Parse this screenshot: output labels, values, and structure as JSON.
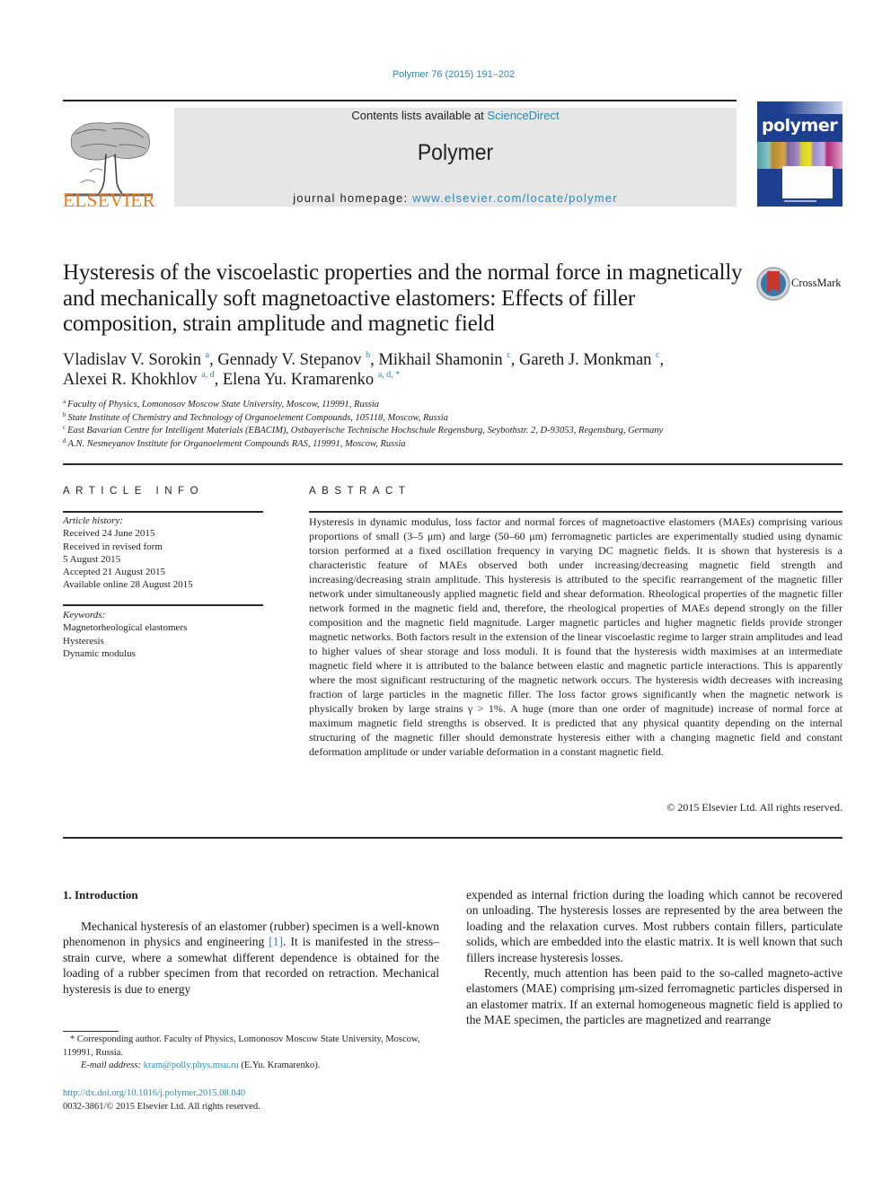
{
  "journal_ref": "Polymer 76 (2015) 191–202",
  "masthead": {
    "contents_prefix": "Contents lists available at ",
    "contents_link": "ScienceDirect",
    "journal_name": "Polymer",
    "homepage_prefix": "journal homepage: ",
    "homepage_link": "www.elsevier.com/locate/polymer"
  },
  "publisher_logo": {
    "name": "ELSEVIER",
    "icon": "elsevier-tree-icon",
    "color": "#ea7a1c"
  },
  "cover": {
    "title": "polymer",
    "icon": "journal-cover-image"
  },
  "crossmark": {
    "label": "CrossMark",
    "icon": "crossmark-icon"
  },
  "article": {
    "title": "Hysteresis of the viscoelastic properties and the normal force in magnetically and mechanically soft magnetoactive elastomers: Effects of filler composition, strain amplitude and magnetic field",
    "authors": [
      {
        "name": "Vladislav V. Sorokin",
        "sup": "a"
      },
      {
        "name": "Gennady V. Stepanov",
        "sup": "b"
      },
      {
        "name": "Mikhail Shamonin",
        "sup": "c"
      },
      {
        "name": "Gareth J. Monkman",
        "sup": "c"
      },
      {
        "name": "Alexei R. Khokhlov",
        "sup": "a, d"
      },
      {
        "name": "Elena Yu. Kramarenko",
        "sup": "a, d, *"
      }
    ],
    "affiliations": [
      {
        "key": "a",
        "text": "Faculty of Physics, Lomonosov Moscow State University, Moscow, 119991, Russia"
      },
      {
        "key": "b",
        "text": "State Institute of Chemistry and Technology of Organoelement Compounds, 105118, Moscow, Russia"
      },
      {
        "key": "c",
        "text": "East Bavarian Centre for Intelligent Materials (EBACIM), Ostbayerische Technische Hochschule Regensburg, Seybothstr. 2, D-93053, Regensburg, Germany"
      },
      {
        "key": "d",
        "text": "A.N. Nesmeyanov Institute for Organoelement Compounds RAS, 119991, Moscow, Russia"
      }
    ]
  },
  "article_info": {
    "heading": "ARTICLE INFO",
    "history_label": "Article history:",
    "history": [
      "Received 24 June 2015",
      "Received in revised form",
      "5 August 2015",
      "Accepted 21 August 2015",
      "Available online 28 August 2015"
    ],
    "keywords_label": "Keywords:",
    "keywords": [
      "Magnetorheological elastomers",
      "Hysteresis",
      "Dynamic modulus"
    ]
  },
  "abstract": {
    "heading": "ABSTRACT",
    "text": "Hysteresis in dynamic modulus, loss factor and normal forces of magnetoactive elastomers (MAEs) comprising various proportions of small (3–5 μm) and large (50–60 μm) ferromagnetic particles are experimentally studied using dynamic torsion performed at a fixed oscillation frequency in varying DC magnetic fields. It is shown that hysteresis is a characteristic feature of MAEs observed both under increasing/decreasing magnetic field strength and increasing/decreasing strain amplitude. This hysteresis is attributed to the specific rearrangement of the magnetic filler network under simultaneously applied magnetic field and shear deformation. Rheological properties of the magnetic filler network formed in the magnetic field and, therefore, the rheological properties of MAEs depend strongly on the filler composition and the magnetic field magnitude. Larger magnetic particles and higher magnetic fields provide stronger magnetic networks. Both factors result in the extension of the linear viscoelastic regime to larger strain amplitudes and lead to higher values of shear storage and loss moduli. It is found that the hysteresis width maximises at an intermediate magnetic field where it is attributed to the balance between elastic and magnetic particle interactions. This is apparently where the most significant restructuring of the magnetic network occurs. The hysteresis width decreases with increasing fraction of large particles in the magnetic filler. The loss factor grows significantly when the magnetic network is physically broken by large strains γ > 1%. A huge (more than one order of magnitude) increase of normal force at maximum magnetic field strengths is observed. It is predicted that any physical quantity depending on the internal structuring of the magnetic filler should demonstrate hysteresis either with a changing magnetic field and constant deformation amplitude or under variable deformation in a constant magnetic field.",
    "copyright": "© 2015 Elsevier Ltd. All rights reserved."
  },
  "introduction": {
    "heading": "1.  Introduction",
    "p1_before_ref": "Mechanical hysteresis of an elastomer (rubber) specimen is a well-known phenomenon in physics and engineering ",
    "p1_ref": "[1]",
    "p1_after_ref": ". It is manifested in the stress–strain curve, where a somewhat different dependence is obtained for the loading of a rubber specimen from that recorded on retraction. Mechanical hysteresis is due to energy",
    "p1_continued": "expended as internal friction during the loading which cannot be recovered on unloading. The hysteresis losses are represented by the area between the loading and the relaxation curves. Most rubbers contain fillers, particulate solids, which are embedded into the elastic matrix. It is well known that such fillers increase hysteresis losses.",
    "p2": "Recently, much attention has been paid to the so-called magneto-active elastomers (MAE) comprising μm-sized ferromagnetic particles dispersed in an elastomer matrix. If an external homogeneous magnetic field is applied to the MAE specimen, the particles are magnetized and rearrange"
  },
  "footnotes": {
    "corresponding": "* Corresponding author. Faculty of Physics, Lomonosov Moscow State University, Moscow, 119991, Russia.",
    "email_label": "E-mail address: ",
    "email": "kram@polly.phys.msu.ru",
    "email_owner": " (E.Yu. Kramarenko).",
    "doi": "http://dx.doi.org/10.1016/j.polymer.2015.08.040",
    "issn_copyright": "0032-3861/© 2015 Elsevier Ltd. All rights reserved."
  }
}
